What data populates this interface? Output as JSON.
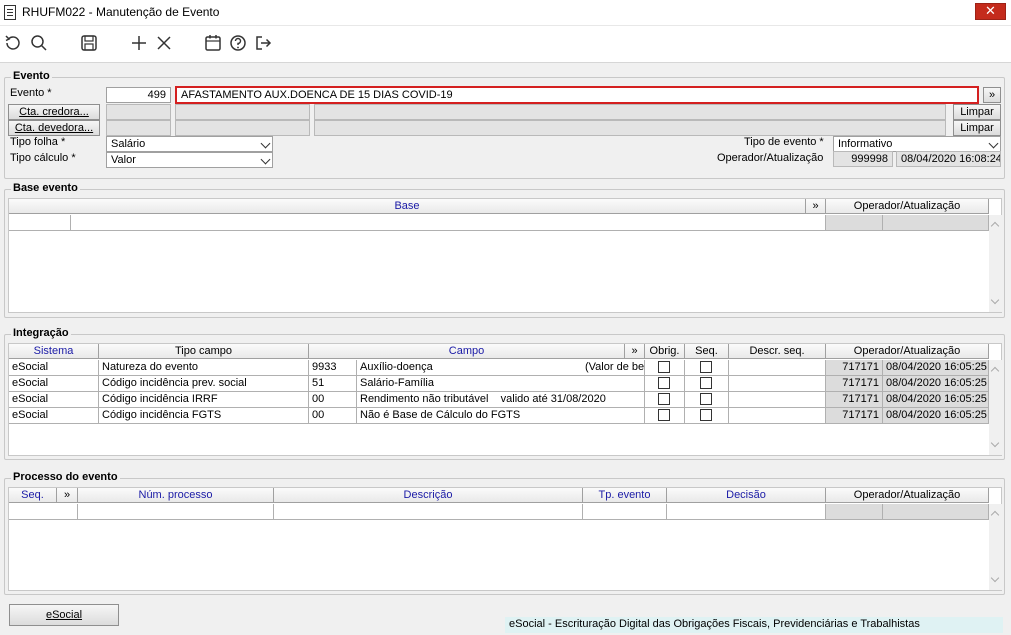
{
  "window": {
    "title": "RHUFM022 - Manutenção de Evento",
    "close_label": "✕"
  },
  "toolbar": {
    "icons": [
      "refresh-icon",
      "search-icon",
      "save-icon",
      "add-icon",
      "delete-icon",
      "calendar-icon",
      "help-icon",
      "exit-icon"
    ]
  },
  "evento": {
    "group_title": "Evento",
    "evento_label": "Evento *",
    "evento_code": "499",
    "evento_desc": "AFASTAMENTO AUX.DOENCA DE 15 DIAS COVID-19",
    "more_label": "»",
    "cta_credora_label": "Cta. credora...",
    "cta_devedora_label": "Cta. devedora...",
    "limpar_label": "Limpar",
    "tipo_folha_label": "Tipo folha *",
    "tipo_folha_value": "Salário",
    "tipo_calculo_label": "Tipo cálculo *",
    "tipo_calculo_value": "Valor",
    "tipo_evento_label": "Tipo de evento *",
    "tipo_evento_value": "Informativo",
    "operador_label": "Operador/Atualização",
    "operador_value": "999998",
    "atualizacao_value": "08/04/2020 16:08:24"
  },
  "base_evento": {
    "group_title": "Base evento",
    "col_base": "Base",
    "col_more": "»",
    "col_operador": "Operador/Atualização"
  },
  "integracao": {
    "group_title": "Integração",
    "columns": {
      "sistema": "Sistema",
      "tipo_campo": "Tipo campo",
      "campo": "Campo",
      "more": "»",
      "obrig": "Obrig.",
      "seq": "Seq.",
      "descr_seq": "Descr. seq.",
      "operador": "Operador/Atualização"
    },
    "rows": [
      {
        "sistema": "eSocial",
        "tipo_campo": "Natureza do evento",
        "codigo": "9933",
        "campo": "Auxílio-doença",
        "extra": "(Valor de be",
        "operador": "717171",
        "data": "08/04/2020 16:05:25"
      },
      {
        "sistema": "eSocial",
        "tipo_campo": "Código incidência prev. social",
        "codigo": "51",
        "campo": "Salário-Família",
        "extra": "",
        "operador": "717171",
        "data": "08/04/2020 16:05:25"
      },
      {
        "sistema": "eSocial",
        "tipo_campo": "Código incidência IRRF",
        "codigo": "00",
        "campo": "Rendimento não tributável    valido até 31/08/2020",
        "extra": "",
        "operador": "717171",
        "data": "08/04/2020 16:05:25"
      },
      {
        "sistema": "eSocial",
        "tipo_campo": "Código incidência FGTS",
        "codigo": "00",
        "campo": "Não é Base de Cálculo do FGTS",
        "extra": "",
        "operador": "717171",
        "data": "08/04/2020 16:05:25"
      }
    ]
  },
  "processo": {
    "group_title": "Processo do evento",
    "columns": {
      "seq": "Seq.",
      "more": "»",
      "num_processo": "Núm. processo",
      "descricao": "Descrição",
      "tp_evento": "Tp. evento",
      "decisao": "Decisão",
      "operador": "Operador/Atualização"
    }
  },
  "footer": {
    "esocial_button": "eSocial",
    "status_text": "eSocial - Escrituração Digital das Obrigações Fiscais, Previdenciárias e Trabalhistas"
  }
}
